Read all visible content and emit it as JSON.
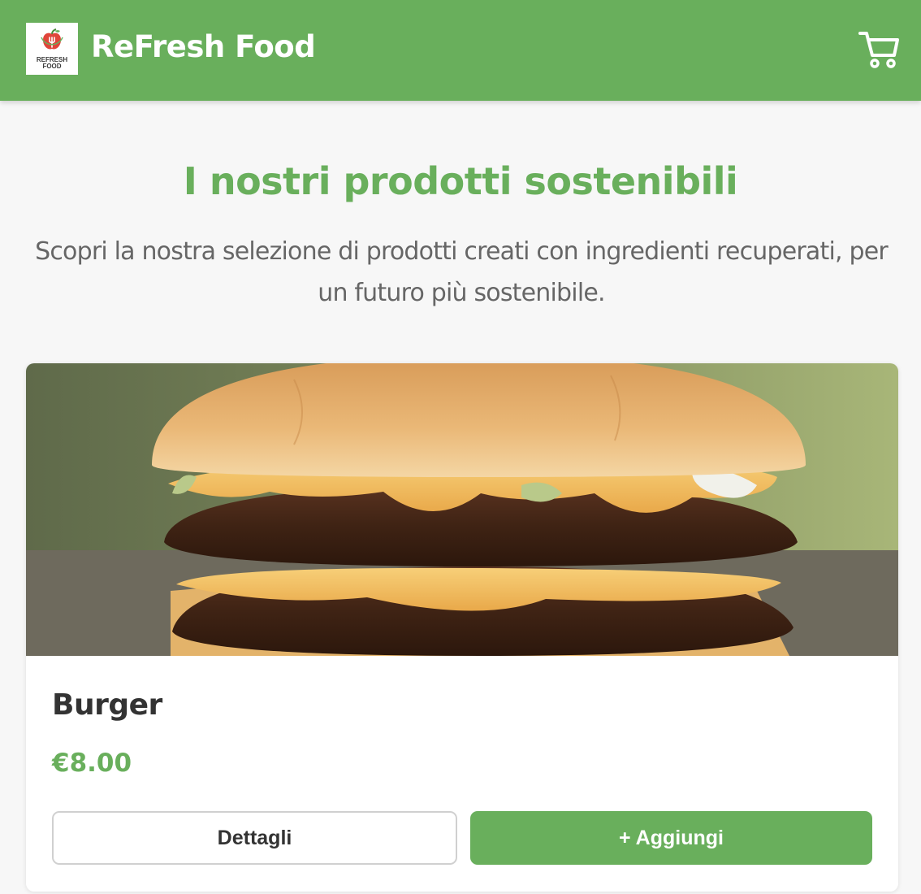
{
  "header": {
    "logo_text": "REFRESH FOOD",
    "brand_name": "ReFresh Food",
    "cart_icon": "cart-icon",
    "brand_color": "#69af5c"
  },
  "main": {
    "title": "I nostri prodotti sostenibili",
    "subtitle": "Scopri la nostra selezione di prodotti creati con ingredienti recuperati, per un futuro più sostenibile."
  },
  "products": [
    {
      "name": "Burger",
      "price": "€8.00",
      "details_label": "Dettagli",
      "add_label": "+ Aggiungi"
    }
  ]
}
